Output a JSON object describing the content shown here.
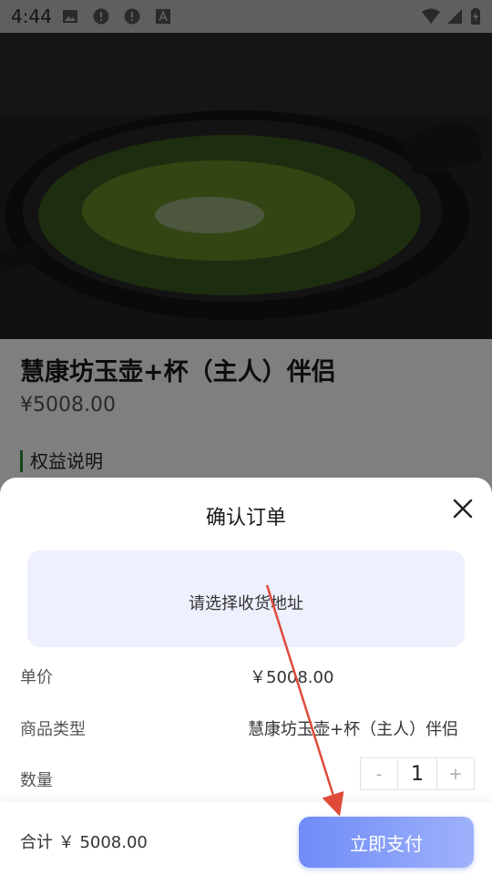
{
  "status_bar": {
    "time": "4:44",
    "icons": [
      "image-icon",
      "alert-icon",
      "alert-icon",
      "a-icon",
      "wifi-icon",
      "signal-icon",
      "battery-icon"
    ]
  },
  "product": {
    "title": "慧康坊玉壶+杯（主人）伴侣",
    "price": "¥5008.00",
    "benefits_heading": "权益说明"
  },
  "order_sheet": {
    "title": "确认订单",
    "address_placeholder": "请选择收货地址",
    "unit_price_label": "单价",
    "unit_price_value": "￥5008.00",
    "product_type_label": "商品类型",
    "product_type_value": "慧康坊玉壶+杯（主人）伴侣",
    "quantity_label": "数量",
    "quantity_minus": "-",
    "quantity_value": "1",
    "quantity_plus": "+",
    "total_label": "合计 ￥ 5008.00",
    "pay_button": "立即支付"
  },
  "colors": {
    "accent": "#6f8cf7",
    "benefit_bar": "#2e8b3a",
    "annotation_arrow": "#e04a3a"
  }
}
